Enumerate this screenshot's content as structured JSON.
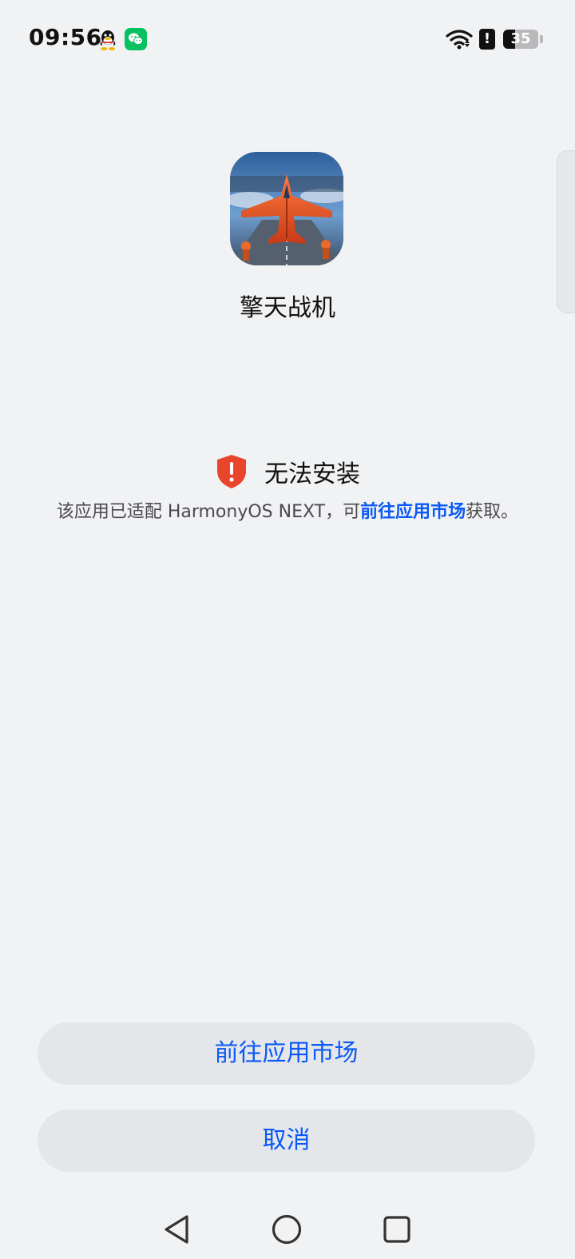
{
  "status_bar": {
    "time": "09:56",
    "battery_level": "35",
    "battery_fraction": 0.35,
    "icons": [
      "qq-icon",
      "wechat-icon",
      "wifi-icon",
      "alert-icon",
      "battery-icon"
    ],
    "alert_glyph": "!"
  },
  "app": {
    "name": "擎天战机"
  },
  "install_status": {
    "title": "无法安装",
    "description_prefix": "该应用已适配 HarmonyOS NEXT，可",
    "description_link": "前往应用市场",
    "description_suffix": "获取。",
    "icon": "shield-alert-icon",
    "icon_color": "#e8452c"
  },
  "buttons": {
    "market_label": "前往应用市场",
    "cancel_label": "取消"
  },
  "nav_bar": {
    "icons": [
      "back-icon",
      "home-icon",
      "recent-apps-icon"
    ]
  },
  "colors": {
    "accent": "#0a59f7",
    "background": "#f1f2f4",
    "button_background": "#e5e6e9"
  }
}
